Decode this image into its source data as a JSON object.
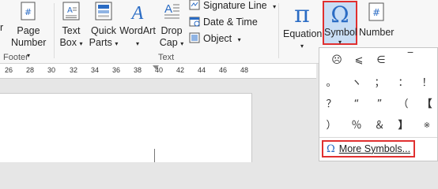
{
  "ribbon": {
    "header_footer_group": {
      "page_number_label_1": "Page",
      "page_number_label_2": "Number",
      "footer_label": "Footer",
      "partial_left_letter": "r"
    },
    "text_group": {
      "label": "Text",
      "text_box_1": "Text",
      "text_box_2": "Box",
      "quick_parts_1": "Quick",
      "quick_parts_2": "Parts",
      "wordart": "WordArt",
      "drop_cap_1": "Drop",
      "drop_cap_2": "Cap",
      "signature_line": "Signature Line",
      "date_time": "Date & Time",
      "object": "Object"
    },
    "symbols_group": {
      "equation": "Equation",
      "symbol": "Symbol",
      "number": "Number"
    }
  },
  "ruler": {
    "numbers": [
      "26",
      "28",
      "30",
      "32",
      "34",
      "36",
      "38",
      "40",
      "42",
      "44",
      "46",
      "48"
    ]
  },
  "symbol_panel": {
    "symbols": [
      "☹",
      "⩽",
      "∈",
      "‾",
      "。",
      "ヽ",
      "；",
      "：",
      "！",
      "？",
      "“",
      "”",
      "（",
      "【",
      "）",
      "％",
      "＆",
      "】",
      "※"
    ],
    "more_symbols": "More Symbols..."
  },
  "colors": {
    "highlight": "#e03030",
    "icon_blue": "#2b6cc4"
  }
}
